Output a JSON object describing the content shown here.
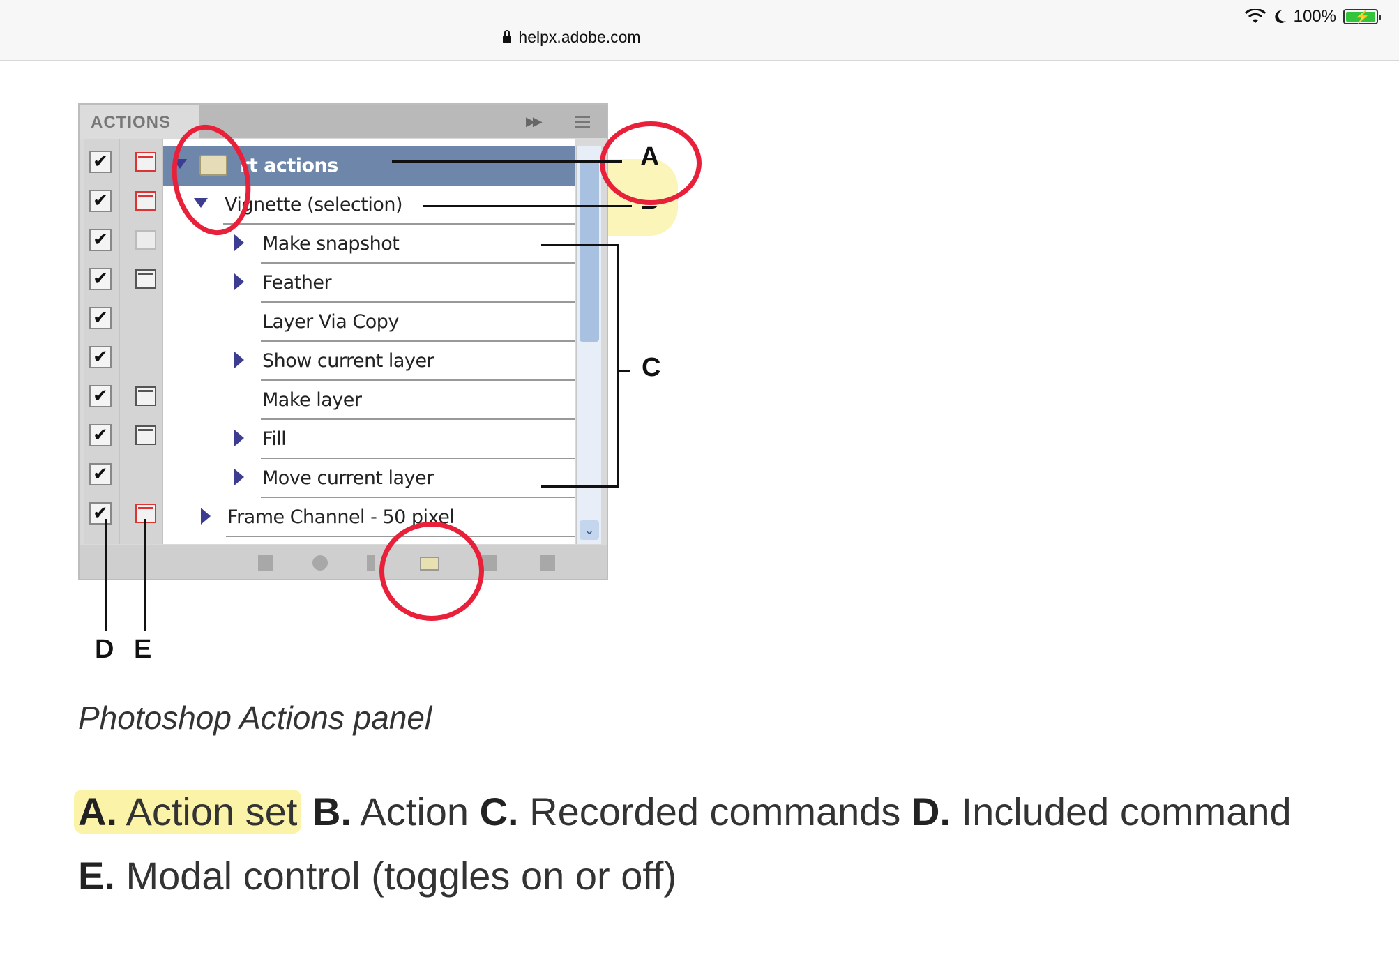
{
  "status_bar": {
    "battery": "100%"
  },
  "browser": {
    "url": "helpx.adobe.com"
  },
  "panel": {
    "title": "ACTIONS",
    "action_set": "Default actions",
    "action_set_visible": "rt actions",
    "action": "Vignette (selection)",
    "action_visible": "Vignette (selection)",
    "commands": [
      "Make snapshot",
      "Feather",
      "Layer Via Copy",
      "Show current layer",
      "Make layer",
      "Fill",
      "Move current layer"
    ],
    "next_action": "Frame Channel - 50 pixel",
    "next_action_visible": "Frame Channel - 50 pixel"
  },
  "callouts": {
    "a": "A",
    "b": "B",
    "c": "C",
    "d": "D",
    "e": "E"
  },
  "caption": "Photoshop Actions panel",
  "legend": [
    {
      "letter": "A.",
      "text": "Action set"
    },
    {
      "letter": "B.",
      "text": "Action"
    },
    {
      "letter": "C.",
      "text": "Recorded commands"
    },
    {
      "letter": "D.",
      "text": "Included command"
    },
    {
      "letter": "E.",
      "text": "Modal control (toggles on or off)"
    }
  ],
  "colors": {
    "annotation_red": "#e8203a",
    "highlight_yellow": "#fbf3a8",
    "selected_row": "#6d86aa"
  }
}
